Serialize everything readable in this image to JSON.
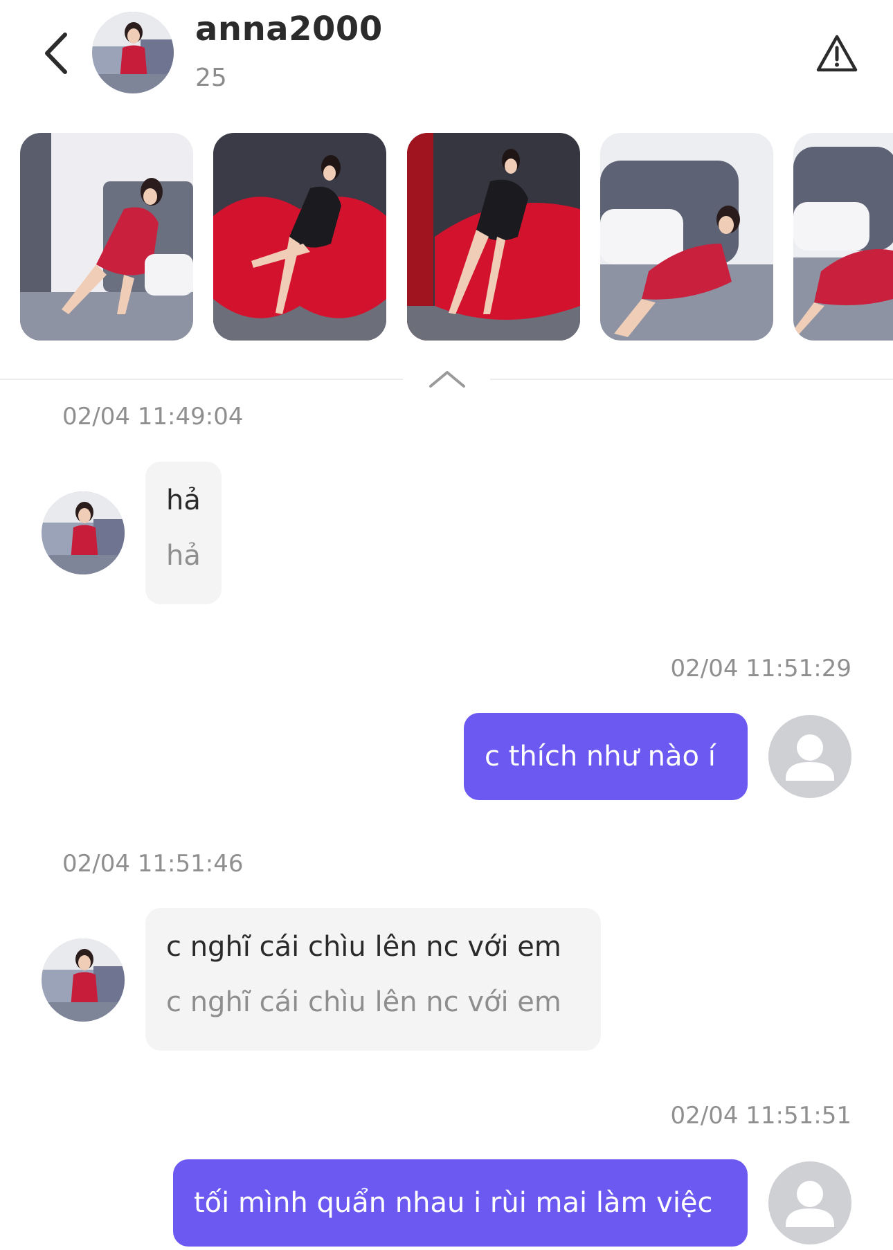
{
  "header": {
    "username": "anna2000",
    "age": "25",
    "back_icon": "chevron-left-icon",
    "report_icon": "warning-triangle-icon"
  },
  "gallery": {
    "photos": [
      {
        "label": "photo-1",
        "dress": "red lingerie",
        "bg": "bedroom"
      },
      {
        "label": "photo-2",
        "dress": "black lace",
        "bg": "red sofa"
      },
      {
        "label": "photo-3",
        "dress": "black lace",
        "bg": "red sofa"
      },
      {
        "label": "photo-4",
        "dress": "red lingerie",
        "bg": "bed"
      },
      {
        "label": "photo-5",
        "dress": "red lingerie",
        "bg": "bed"
      }
    ]
  },
  "messages": [
    {
      "direction": "in",
      "timestamp": "02/04 11:49:04",
      "text": "hả",
      "translation": "hả"
    },
    {
      "direction": "out",
      "timestamp": "02/04 11:51:29",
      "text": "c thích như nào í"
    },
    {
      "direction": "in",
      "timestamp": "02/04 11:51:46",
      "text": "c nghĩ cái chìu lên nc với em",
      "translation": "c nghĩ cái chìu lên nc với em"
    },
    {
      "direction": "out",
      "timestamp": "02/04 11:51:51",
      "text": "tối mình quẩn nhau i rùi mai làm việc"
    }
  ],
  "colors": {
    "accent": "#6b59f2",
    "incoming_bubble": "#f4f4f4",
    "timestamp": "#8f8f8f",
    "placeholder_avatar": "#cfd0d4"
  }
}
